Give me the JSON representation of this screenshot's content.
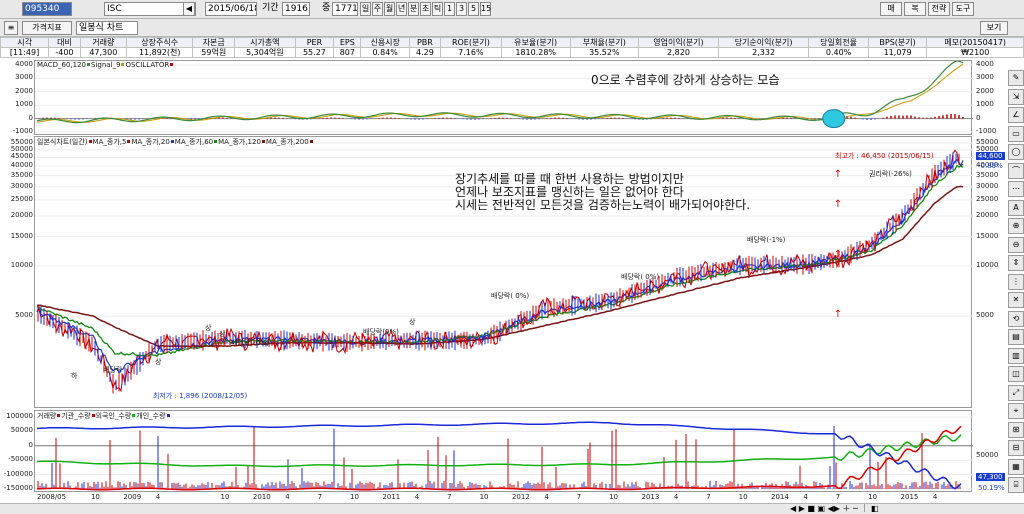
{
  "toolbar": {
    "code": "095340",
    "name": "ISC",
    "date": "2015/06/18",
    "period_label": "기간",
    "period_value": "1916",
    "count_label": "중",
    "count_value": "1771",
    "periods": [
      "일",
      "주",
      "월",
      "년",
      "분",
      "초",
      "틱",
      "1",
      "3",
      "5",
      "15"
    ],
    "right_buttons": [
      "매",
      "복",
      "전략",
      "도구"
    ],
    "r2_left": "가격지표",
    "r2_chart": "일봉식 차트",
    "r2_right": "보기"
  },
  "quote": {
    "headers": [
      "시각",
      "대비",
      "거래량",
      "상장주식수",
      "자본금",
      "시가총액",
      "PER",
      "EPS",
      "신용시장",
      "PBR",
      "ROE(분기)",
      "유보율(분기)",
      "부채율(분기)",
      "영업이익(분기)",
      "당기순이익(분기)",
      "당일회전율",
      "BPS(분기)",
      "메모(20150417)"
    ],
    "values": [
      "[11:49]",
      "-400",
      "47,300",
      "11,892(천)",
      "59억원",
      "5,304억원",
      "55.27",
      "807",
      "0.84%",
      "4.29",
      "7.16%",
      "1810.28%",
      "35.52%",
      "2,820",
      "2,332",
      "0.40%",
      "11,079",
      "₩2100"
    ]
  },
  "macd": {
    "legend": [
      "MACD_60,120",
      "Signal_9",
      "OSCILLATOR"
    ],
    "colors": [
      "#3a8a3a",
      "#c89a00",
      "#c00000"
    ],
    "yticks": [
      "4000",
      "3000",
      "2000",
      "1000",
      "0",
      "-1000"
    ]
  },
  "price": {
    "legend": [
      "일본식차트(일간)",
      "MA_종가,5",
      "MA_종가,20",
      "MA_종가,60",
      "MA_종가,120",
      "MA_종가,200"
    ],
    "colors": [
      "#c00000",
      "#c00000",
      "#1a3ccc",
      "#108a10",
      "#7a1414",
      "#7a1414"
    ],
    "yticks": [
      "55000",
      "50000",
      "45000",
      "40000",
      "35000",
      "30000",
      "25000",
      "20000",
      "15000",
      "10000",
      "5000"
    ],
    "right_value": "44,600",
    "right_change": "-0.89%",
    "high_label": "최고가 : 46,450 (2015/06/15)",
    "low_label": "최저가 : 1,896 (2008/12/05)",
    "annotations": [
      "배당락(-1%)",
      "배당락(0%)",
      "배당락( 0%)",
      "배당락( 0%)",
      "배당락(-0%)",
      "배당락",
      "권리락(-26%)",
      "상",
      "상",
      "상",
      "상",
      "하"
    ]
  },
  "notes": {
    "macd_note": "0으로 수렴후에 강하게 상승하는 모습",
    "line1": "장기추세를 따를 때 한번 사용하는 방법이지만",
    "line2": "언제나 보조지표를 맹신하는 일은 없어야 한다",
    "line3": "시세는 전반적인 모든것을 검증하는노력이 배가되어야한다."
  },
  "volume": {
    "legend": [
      "거래량",
      "기관_수량",
      "외국인_수량",
      "개인_수량"
    ],
    "colors": [
      "#c00000",
      "#c00000",
      "#10b010",
      "#1a28d8"
    ],
    "yticks": [
      "100000",
      "50000",
      "0",
      "-50000",
      "-100000",
      "-150000"
    ],
    "right_ticks": [
      "50000"
    ],
    "right_value": "47,300",
    "right_pct": "50.19%"
  },
  "xaxis": [
    "2008/05",
    "10",
    "2009",
    "4",
    "10",
    "2010",
    "4",
    "7",
    "10",
    "2011",
    "4",
    "7",
    "10",
    "2012",
    "4",
    "7",
    "10",
    "2013",
    "4",
    "7",
    "10",
    "2014",
    "4",
    "7",
    "10",
    "2015",
    "4"
  ],
  "chart_data": {
    "type": "line",
    "title": "",
    "xlabel": "",
    "ylabel": "",
    "x": [
      "2008/05",
      "2008/10",
      "2008/12",
      "2009/04",
      "2009/10",
      "2010/04",
      "2010/10",
      "2011/04",
      "2011/10",
      "2012/04",
      "2012/10",
      "2013/04",
      "2013/10",
      "2014/04",
      "2014/07",
      "2014/10",
      "2015/01",
      "2015/04",
      "2015/06"
    ],
    "series": [
      {
        "name": "일본식차트(일간)",
        "values": [
          5200,
          3400,
          1896,
          3400,
          3700,
          3600,
          3500,
          3600,
          3600,
          5600,
          6200,
          8600,
          10200,
          10300,
          11000,
          13500,
          20000,
          36000,
          44600
        ]
      },
      {
        "name": "MA_종가,20",
        "values": [
          5400,
          3700,
          2300,
          3100,
          3600,
          3600,
          3500,
          3550,
          3700,
          5400,
          6100,
          8300,
          9800,
          10200,
          11000,
          12800,
          19000,
          34000,
          42000
        ]
      },
      {
        "name": "MA_종가,60",
        "values": [
          5600,
          4200,
          3000,
          2900,
          3500,
          3550,
          3500,
          3500,
          3800,
          5000,
          5900,
          7800,
          9400,
          10100,
          10900,
          12300,
          17500,
          31000,
          39500
        ]
      },
      {
        "name": "MA_종가,200",
        "values": [
          5800,
          5000,
          4300,
          3300,
          3300,
          3450,
          3450,
          3400,
          3600,
          4400,
          5400,
          6800,
          8500,
          9800,
          10600,
          11600,
          14500,
          24000,
          30000
        ]
      }
    ],
    "ylim": [
      1500,
      55000
    ],
    "log_scale": true,
    "macd": {
      "name": "MACD_60,120",
      "x": [
        "2008/05",
        "2011/04",
        "2014/07",
        "2015/01",
        "2015/04",
        "2015/06"
      ],
      "values": [
        -200,
        300,
        0,
        1200,
        3000,
        4000
      ],
      "ylim": [
        -1000,
        4000
      ]
    },
    "volume": {
      "ylim": [
        -150000,
        100000
      ],
      "x": [
        "2008/05",
        "2009/10",
        "2012/10",
        "2014/07",
        "2015/06"
      ],
      "series": [
        {
          "name": "외국인_수량",
          "values": [
            -55000,
            -70000,
            -65000,
            -40000,
            30000
          ]
        },
        {
          "name": "개인_수량",
          "values": [
            60000,
            65000,
            80000,
            40000,
            -140000
          ]
        },
        {
          "name": "기관_수량",
          "values": [
            -150000,
            -150000,
            -150000,
            -140000,
            60000
          ]
        }
      ]
    }
  }
}
